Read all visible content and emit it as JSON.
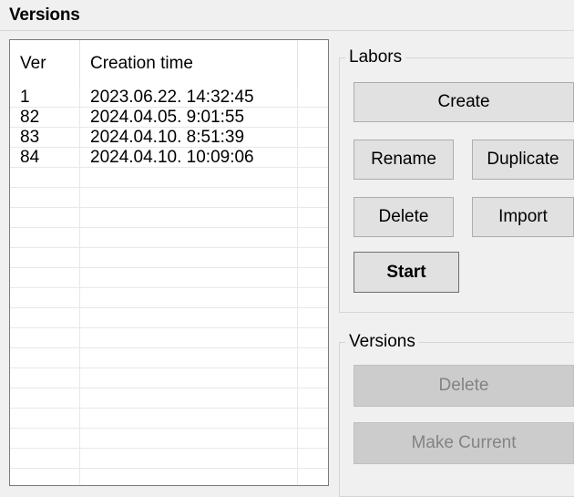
{
  "header": {
    "title": "Versions"
  },
  "table": {
    "columns": {
      "ver": "Ver",
      "creation_time": "Creation time"
    },
    "rows": [
      {
        "ver": "1",
        "time": "2023.06.22. 14:32:45"
      },
      {
        "ver": "82",
        "time": "2024.04.05. 9:01:55"
      },
      {
        "ver": "83",
        "time": "2024.04.10. 8:51:39"
      },
      {
        "ver": "84",
        "time": "2024.04.10. 10:09:06"
      },
      {
        "ver": "",
        "time": ""
      },
      {
        "ver": "",
        "time": ""
      },
      {
        "ver": "",
        "time": ""
      },
      {
        "ver": "",
        "time": ""
      },
      {
        "ver": "",
        "time": ""
      },
      {
        "ver": "",
        "time": ""
      },
      {
        "ver": "",
        "time": ""
      },
      {
        "ver": "",
        "time": ""
      },
      {
        "ver": "",
        "time": ""
      },
      {
        "ver": "",
        "time": ""
      },
      {
        "ver": "",
        "time": ""
      },
      {
        "ver": "",
        "time": ""
      },
      {
        "ver": "",
        "time": ""
      },
      {
        "ver": "",
        "time": ""
      },
      {
        "ver": "",
        "time": ""
      },
      {
        "ver": "",
        "time": ""
      }
    ]
  },
  "labors": {
    "title": "Labors",
    "create": "Create",
    "rename": "Rename",
    "duplicate": "Duplicate",
    "delete": "Delete",
    "import": "Import",
    "start": "Start"
  },
  "versions_group": {
    "title": "Versions",
    "delete": "Delete",
    "make_current": "Make Current"
  }
}
